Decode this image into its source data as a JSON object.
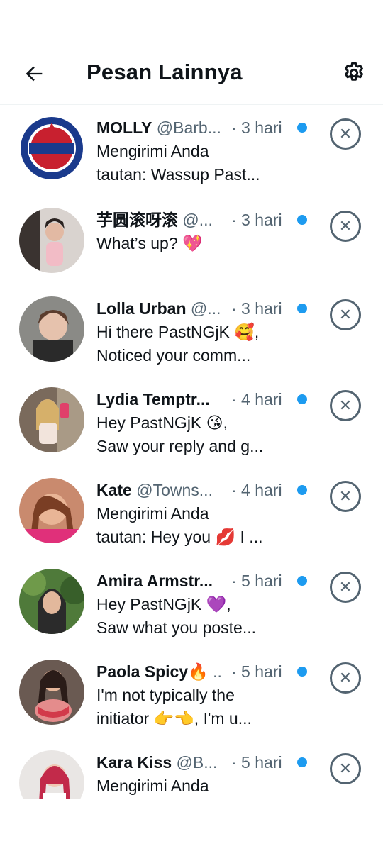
{
  "header": {
    "title": "Pesan Lainnya",
    "back_icon": "arrow-left-icon",
    "settings_icon": "gear-icon"
  },
  "colors": {
    "unread_dot": "#1d9bf0",
    "secondary_text": "#536471",
    "primary_text": "#0f1419"
  },
  "messages": [
    {
      "name": "MOLLY",
      "handle": "@Barb...",
      "time": "· 3 hari",
      "line1": "Mengirimi Anda",
      "line2": "tautan: Wassup Past...",
      "unread": true
    },
    {
      "name": "芋圆滚呀滚",
      "handle": "@...",
      "time": "· 3 hari",
      "line1": "What’s up? 💖",
      "line2": "",
      "unread": true
    },
    {
      "name": "Lolla Urban",
      "handle": "@...",
      "time": "· 3 hari",
      "line1": "Hi there PastNGjK 🥰,",
      "line2": "Noticed your comm...",
      "unread": true
    },
    {
      "name": "Lydia Temptr...",
      "handle": "",
      "time": "· 4 hari",
      "line1": "Hey PastNGjK 😘,",
      "line2": "Saw your reply and g...",
      "unread": true
    },
    {
      "name": "Kate",
      "handle": "@Towns...",
      "time": "· 4 hari",
      "line1": "Mengirimi Anda",
      "line2": "tautan: Hey you 💋 I ...",
      "unread": true
    },
    {
      "name": "Amira Armstr...",
      "handle": "",
      "time": "· 5 hari",
      "line1": "Hey PastNGjK 💜,",
      "line2": "Saw what you poste...",
      "unread": true
    },
    {
      "name": "Paola Spicy🔥",
      "handle": "..",
      "time": "· 5 hari",
      "line1": "I'm not typically the",
      "line2": "initiator 👉👈, I'm u...",
      "unread": true
    },
    {
      "name": "Kara Kiss",
      "handle": "@B...",
      "time": "· 5 hari",
      "line1": "Mengirimi Anda",
      "line2": "",
      "unread": true
    }
  ]
}
